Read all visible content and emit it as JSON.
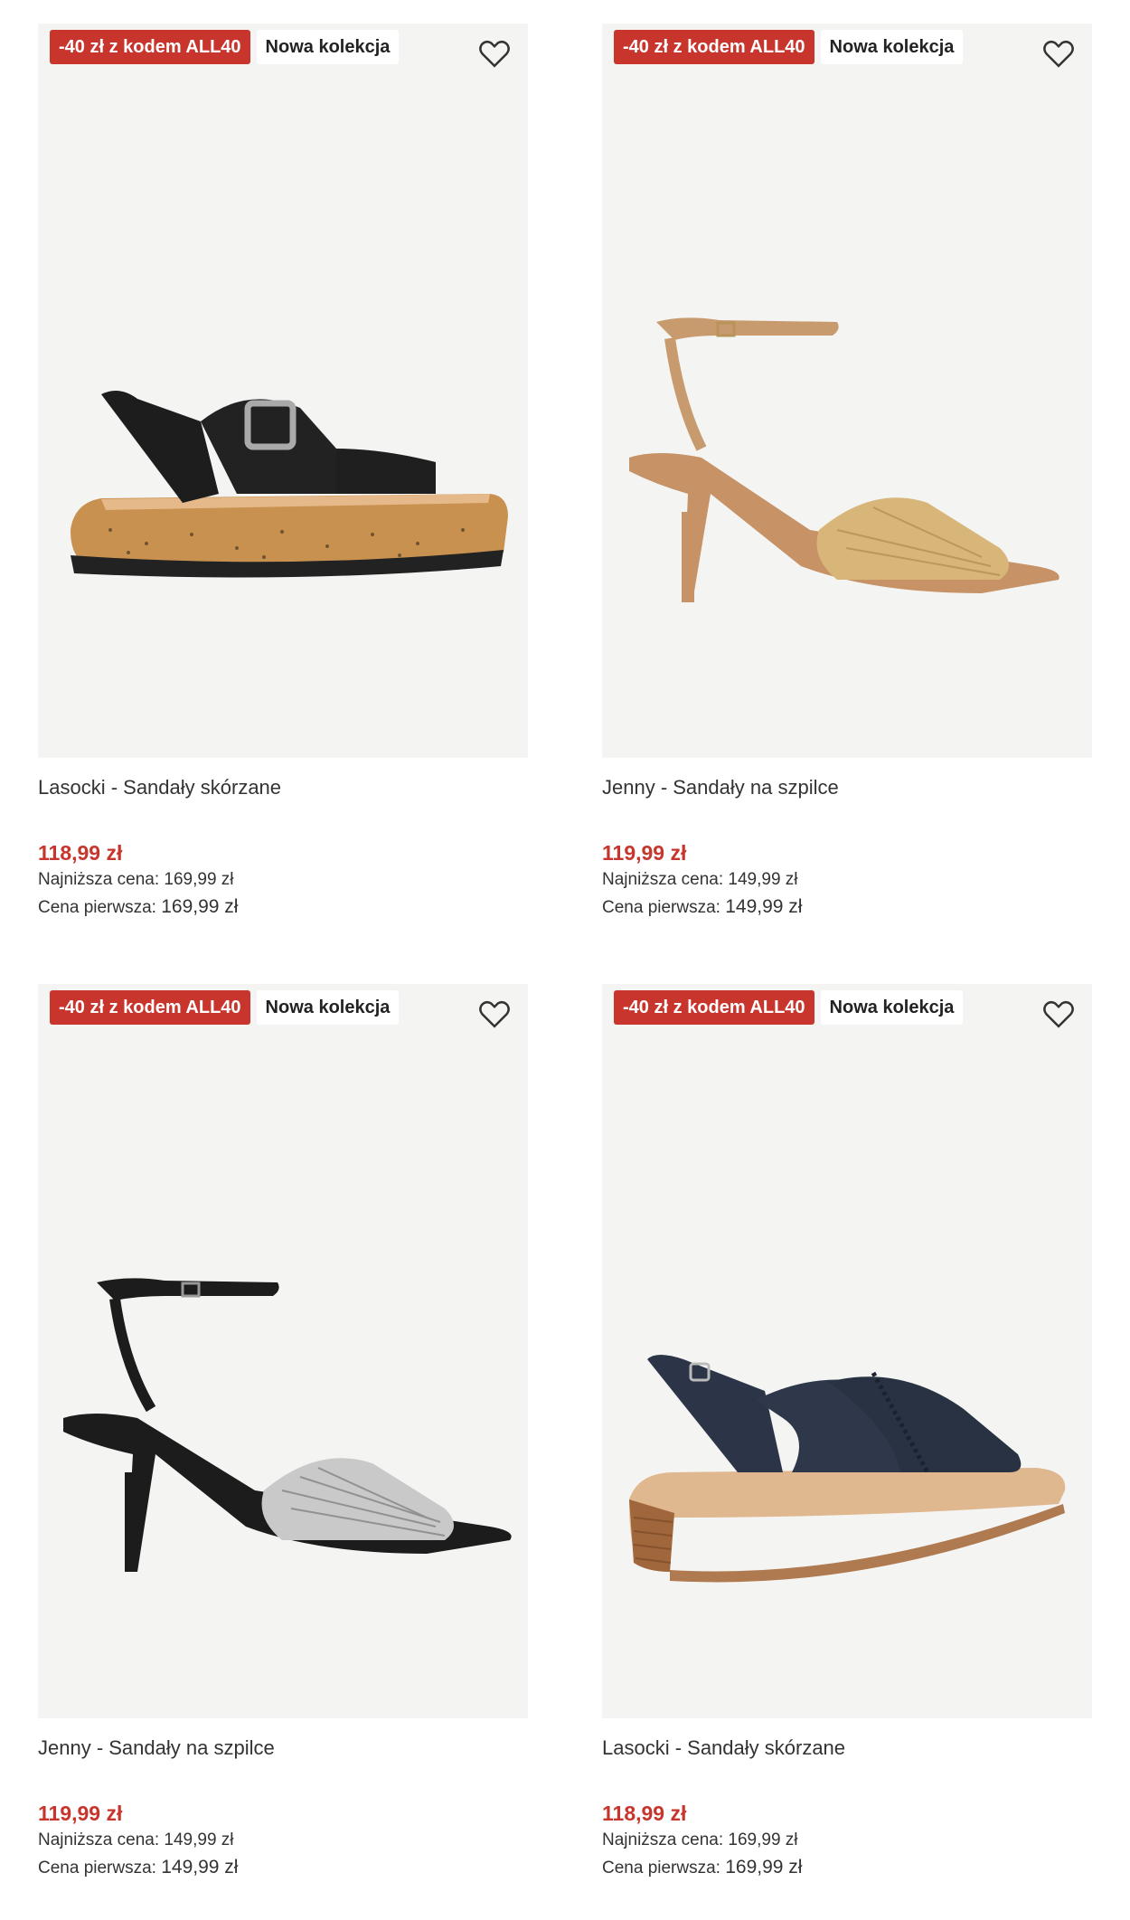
{
  "colors": {
    "promo_badge": "#c8352d",
    "price": "#c8352d",
    "image_bg": "#f4f4f3",
    "text": "#333333"
  },
  "labels": {
    "lowest_price": "Najniższa cena:",
    "first_price": "Cena pierwsza:"
  },
  "products": [
    {
      "promo_badge": "-40 zł z kodem ALL40",
      "new_badge": "Nowa kolekcja",
      "name": "Lasocki - Sandały skórzane",
      "price": "118,99 zł",
      "lowest_price": "169,99 zł",
      "first_price": "169,99 zł",
      "favorite_icon": "heart-outline-icon",
      "image": "black-leather-platform-sandal"
    },
    {
      "promo_badge": "-40 zł z kodem ALL40",
      "new_badge": "Nowa kolekcja",
      "name": "Jenny - Sandały na szpilce",
      "price": "119,99 zł",
      "lowest_price": "149,99 zł",
      "first_price": "149,99 zł",
      "favorite_icon": "heart-outline-icon",
      "image": "tan-gold-heeled-sandal"
    },
    {
      "promo_badge": "-40 zł z kodem ALL40",
      "new_badge": "Nowa kolekcja",
      "name": "Jenny - Sandały na szpilce",
      "price": "119,99 zł",
      "lowest_price": "149,99 zł",
      "first_price": "149,99 zł",
      "favorite_icon": "heart-outline-icon",
      "image": "black-silver-heeled-sandal"
    },
    {
      "promo_badge": "-40 zł z kodem ALL40",
      "new_badge": "Nowa kolekcja",
      "name": "Lasocki - Sandały skórzane",
      "price": "118,99 zł",
      "lowest_price": "169,99 zł",
      "first_price": "169,99 zł",
      "favorite_icon": "heart-outline-icon",
      "image": "navy-leather-wedge-sandal"
    }
  ]
}
